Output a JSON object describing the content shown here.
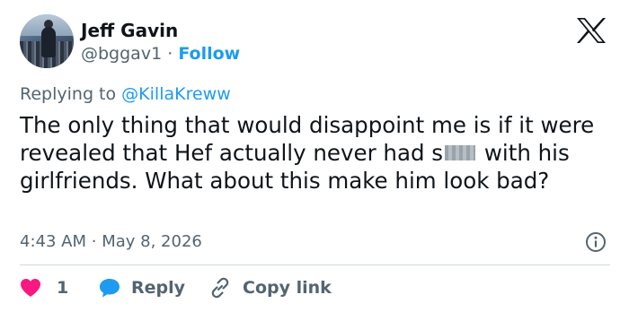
{
  "author": {
    "name": "Jeff Gavin",
    "handle": "@bggav1",
    "separator": "·",
    "follow_label": "Follow"
  },
  "reply_context": {
    "prefix": "Replying to",
    "mention": "@KillaKreww"
  },
  "tweet": {
    "text_before_censor": "The only thing that would disappoint me is if it were revealed that Hef actually never had s",
    "text_after_censor": " with his girlfriends. What about this make him look bad?"
  },
  "meta": {
    "time": "4:43 AM",
    "separator": "·",
    "date": "May 8, 2026"
  },
  "actions": {
    "like_count": "1",
    "reply_label": "Reply",
    "copy_link_label": "Copy link"
  },
  "colors": {
    "accent": "#1d9bf0",
    "heart": "#f91880",
    "muted_text": "#536471",
    "main_text": "#0f1419"
  },
  "icons": [
    "x-logo-icon",
    "info-icon",
    "heart-icon",
    "reply-bubble-icon",
    "link-icon"
  ]
}
